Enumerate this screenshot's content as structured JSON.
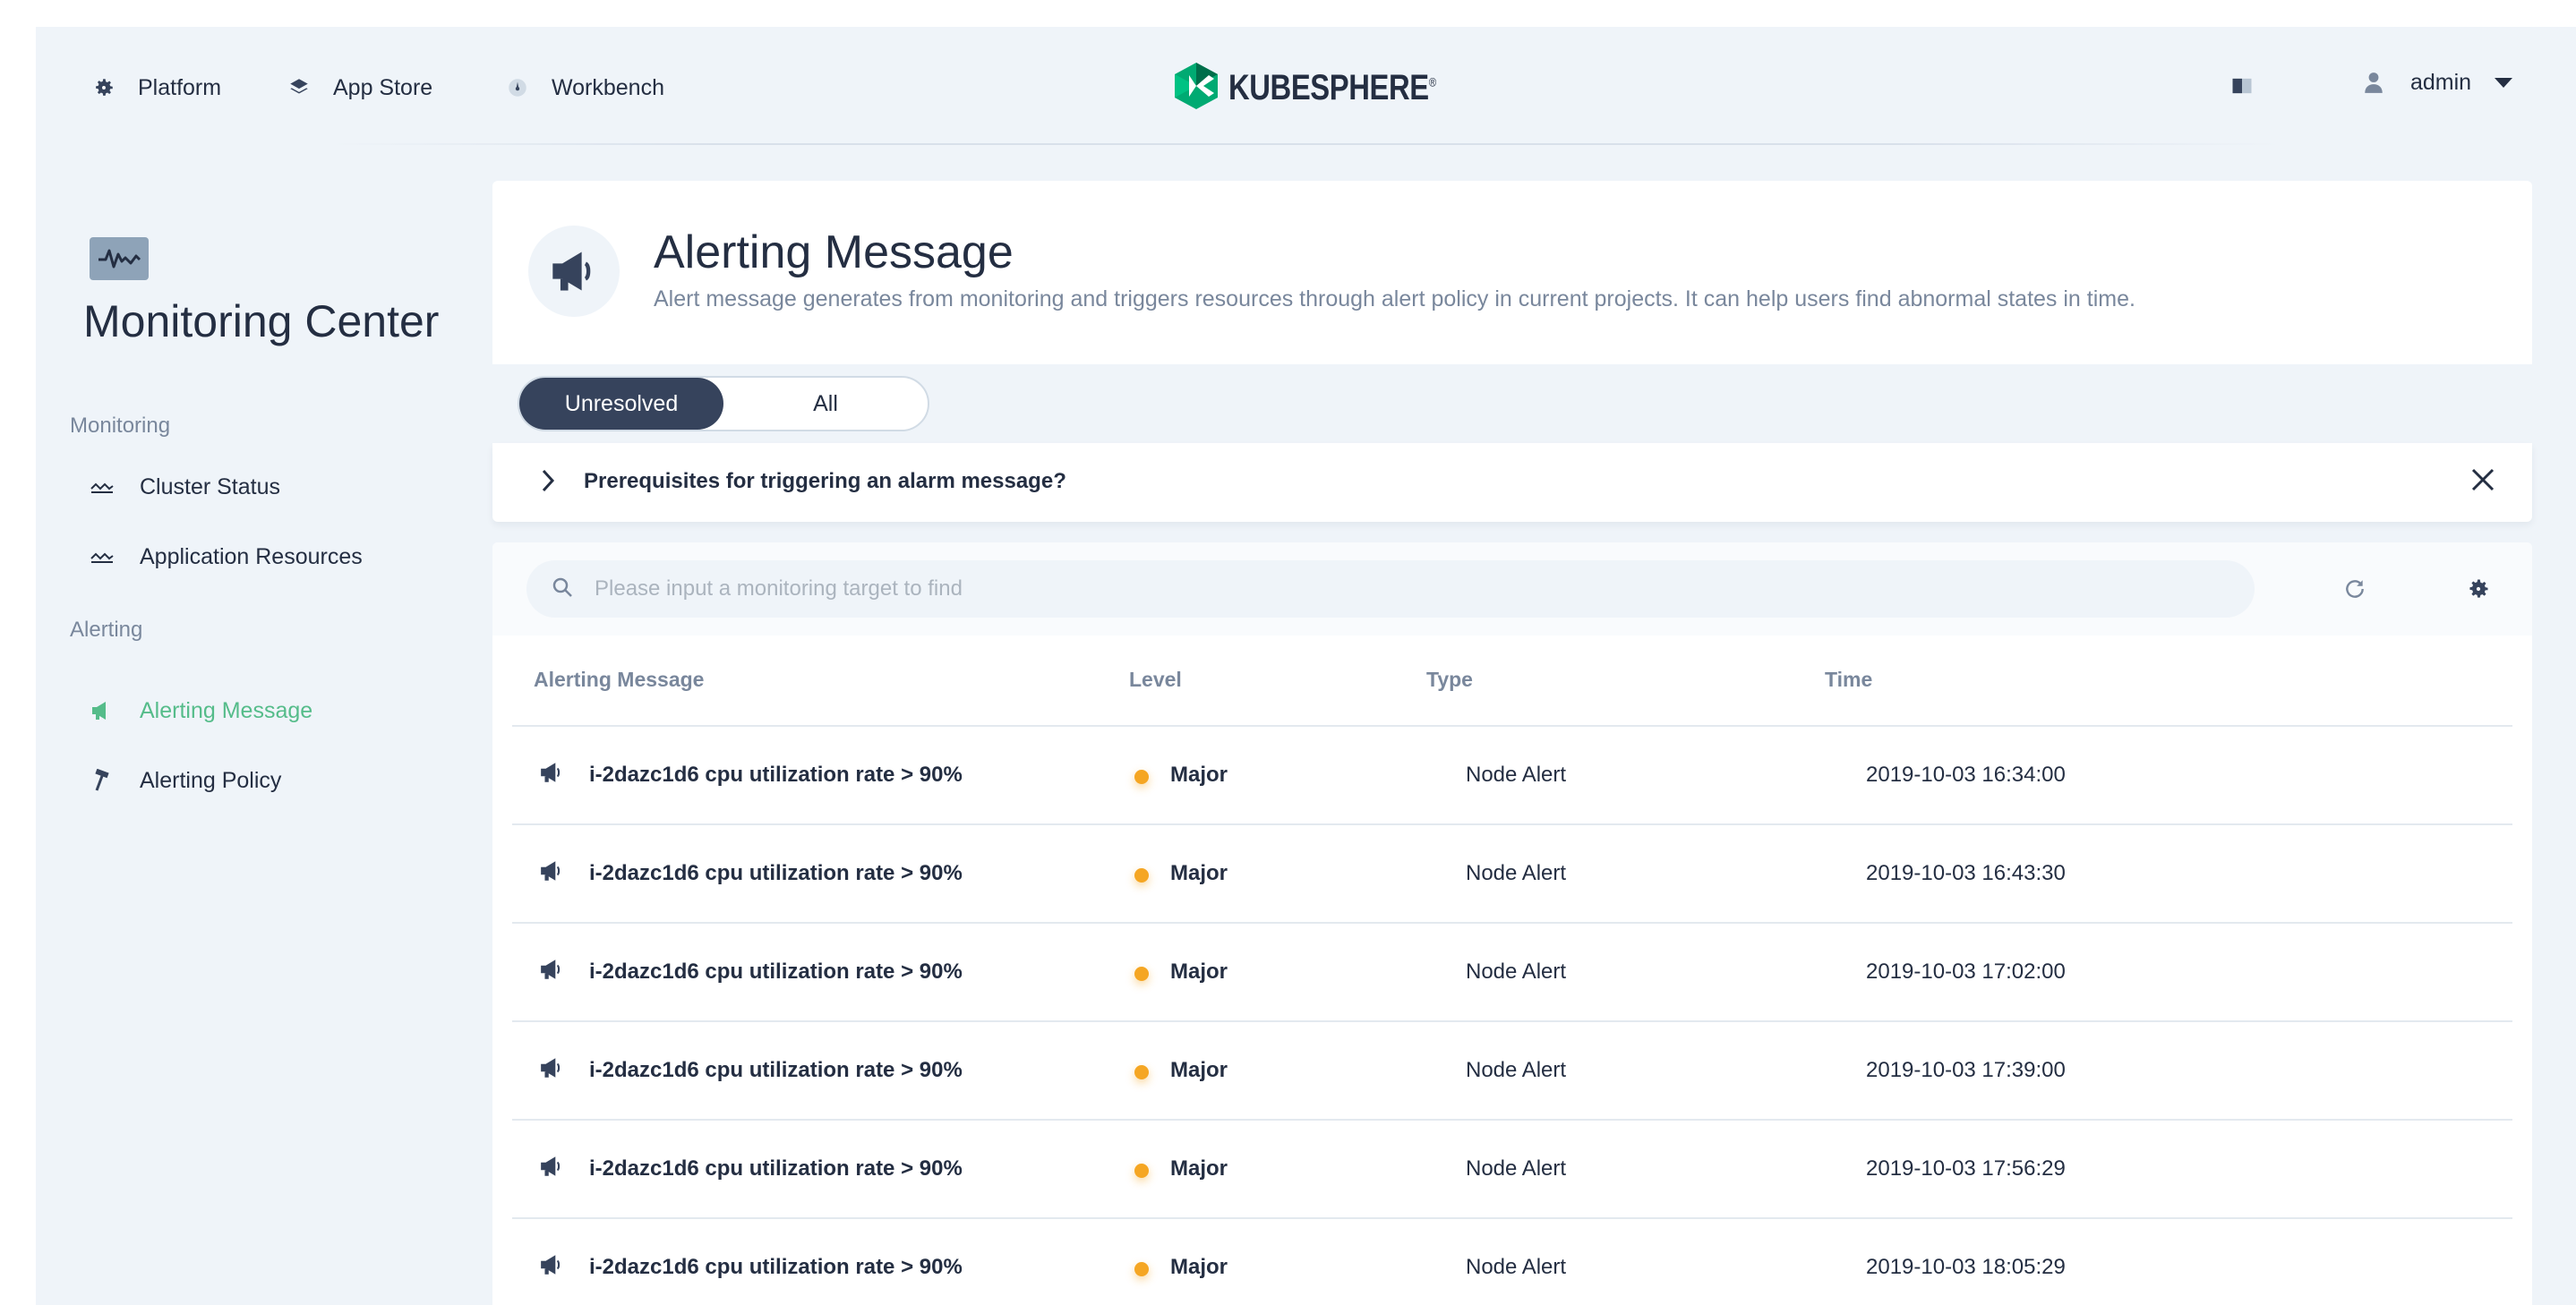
{
  "nav": {
    "items": [
      {
        "label": "Platform",
        "icon": "gear-icon"
      },
      {
        "label": "App Store",
        "icon": "layers-icon"
      },
      {
        "label": "Workbench",
        "icon": "dashboard-icon"
      }
    ],
    "brand": "KUBESPHERE",
    "brand_mark": "®",
    "user": "admin"
  },
  "sidebar": {
    "title": "Monitoring Center",
    "groups": [
      {
        "label": "Monitoring",
        "items": [
          {
            "label": "Cluster Status",
            "icon": "wave-icon"
          },
          {
            "label": "Application Resources",
            "icon": "wave-icon"
          }
        ]
      },
      {
        "label": "Alerting",
        "items": [
          {
            "label": "Alerting Message",
            "icon": "megaphone-icon",
            "active": true
          },
          {
            "label": "Alerting Policy",
            "icon": "hammer-icon"
          }
        ]
      }
    ]
  },
  "header": {
    "title": "Alerting Message",
    "description": "Alert message generates from monitoring and triggers resources through alert policy in current projects. It can help users find abnormal states in time."
  },
  "tabs": {
    "options": [
      "Unresolved",
      "All"
    ],
    "active": "Unresolved"
  },
  "prereq": {
    "label": "Prerequisites for triggering an alarm message?"
  },
  "search": {
    "placeholder": "Please input a monitoring target to find"
  },
  "table": {
    "columns": [
      "Alerting Message",
      "Level",
      "Type",
      "Time"
    ],
    "rows": [
      {
        "message": "i-2dazc1d6 cpu utilization rate > 90%",
        "level": "Major",
        "type": "Node Alert",
        "time": "2019-10-03 16:34:00"
      },
      {
        "message": "i-2dazc1d6 cpu utilization rate > 90%",
        "level": "Major",
        "type": "Node Alert",
        "time": "2019-10-03 16:43:30"
      },
      {
        "message": "i-2dazc1d6 cpu utilization rate > 90%",
        "level": "Major",
        "type": "Node Alert",
        "time": "2019-10-03 17:02:00"
      },
      {
        "message": "i-2dazc1d6 cpu utilization rate > 90%",
        "level": "Major",
        "type": "Node Alert",
        "time": "2019-10-03 17:39:00"
      },
      {
        "message": "i-2dazc1d6 cpu utilization rate > 90%",
        "level": "Major",
        "type": "Node Alert",
        "time": "2019-10-03 17:56:29"
      },
      {
        "message": "i-2dazc1d6 cpu utilization rate > 90%",
        "level": "Major",
        "type": "Node Alert",
        "time": "2019-10-03 18:05:29"
      }
    ]
  },
  "colors": {
    "accent": "#55bc8a",
    "major": "#f5a623",
    "primary_dark": "#36435c",
    "background": "#eff4f9"
  }
}
